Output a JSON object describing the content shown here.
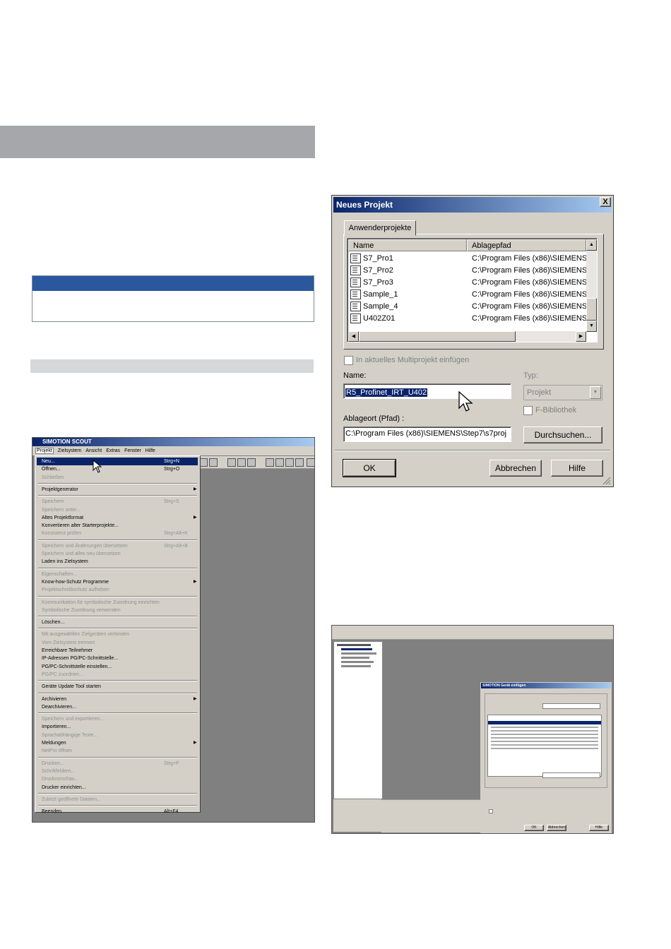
{
  "neues_projekt": {
    "title": "Neues Projekt",
    "close": "X",
    "tab_label": "Anwenderprojekte",
    "columns": [
      "Name",
      "Ablagepfad"
    ],
    "rows": [
      {
        "name": "S7_Pro1",
        "path": "C:\\Program Files (x86)\\SIEMENS\\"
      },
      {
        "name": "S7_Pro2",
        "path": "C:\\Program Files (x86)\\SIEMENS\\"
      },
      {
        "name": "S7_Pro3",
        "path": "C:\\Program Files (x86)\\SIEMENS\\"
      },
      {
        "name": "Sample_1",
        "path": "C:\\Program Files (x86)\\SIEMENS\\"
      },
      {
        "name": "Sample_4",
        "path": "C:\\Program Files (x86)\\SIEMENS\\"
      },
      {
        "name": "U402Z01",
        "path": "C:\\Program Files (x86)\\SIEMENS\\"
      }
    ],
    "multiprojekt_label": "In aktuelles Multiprojekt einfügen",
    "name_label": "Name:",
    "name_value": "R5_Profinet_IRT_U402",
    "typ_label": "Typ:",
    "typ_value": "Projekt",
    "fbib_label": "F-Bibliothek",
    "ablageort_label": "Ablageort (Pfad) :",
    "ablageort_value": "C:\\Program Files (x86)\\SIEMENS\\Step7\\s7proj",
    "durchsuchen_label": "Durchsuchen...",
    "ok_label": "OK",
    "abbrechen_label": "Abbrechen",
    "hilfe_label": "Hilfe"
  },
  "scout": {
    "title": "SIMOTION SCOUT",
    "menubar": [
      "Projekt",
      "Zielsystem",
      "Ansicht",
      "Extras",
      "Fenster",
      "Hilfe"
    ],
    "menu_items": [
      {
        "label": "Neu...",
        "shortcut": "Strg+N",
        "disabled": false,
        "highlight": true
      },
      {
        "label": "Öffnen...",
        "shortcut": "Strg+O",
        "disabled": false
      },
      {
        "label": "Schließen",
        "shortcut": "",
        "disabled": true
      },
      {
        "label": "Projektgenerator",
        "shortcut": "",
        "disabled": false,
        "submenu": true
      },
      {
        "label": "Speichern",
        "shortcut": "Strg+S",
        "disabled": true
      },
      {
        "label": "Speichern unter...",
        "shortcut": "",
        "disabled": true
      },
      {
        "label": "Altes Projektformat",
        "shortcut": "",
        "disabled": false,
        "submenu": true
      },
      {
        "label": "Konvertieren alter Starterprojekte...",
        "shortcut": "",
        "disabled": false
      },
      {
        "label": "Konsistenz prüfen",
        "shortcut": "Strg+Alt+K",
        "disabled": true
      },
      {
        "label": "Speichern und Änderungen übersetzen",
        "shortcut": "Strg+Alt+B",
        "disabled": true
      },
      {
        "label": "Speichern und alles neu übersetzen",
        "shortcut": "",
        "disabled": true
      },
      {
        "label": "Laden ins Zielsystem",
        "shortcut": "",
        "disabled": false
      },
      {
        "label": "Eigenschaften...",
        "shortcut": "",
        "disabled": true
      },
      {
        "label": "Know-how-Schutz Programme",
        "shortcut": "",
        "disabled": false,
        "submenu": true
      },
      {
        "label": "Projektschreibschutz aufheben",
        "shortcut": "",
        "disabled": true
      },
      {
        "label": "Kommunikation für symbolische Zuordnung einrichten",
        "shortcut": "",
        "disabled": true
      },
      {
        "label": "Symbolische Zuordnung verwenden",
        "shortcut": "",
        "disabled": true
      },
      {
        "label": "Löschen...",
        "shortcut": "",
        "disabled": false
      },
      {
        "label": "Mit ausgewählten Zielgeräten verbinden",
        "shortcut": "",
        "disabled": true
      },
      {
        "label": "Vom Zielsystem trennen",
        "shortcut": "",
        "disabled": true
      },
      {
        "label": "Erreichbare Teilnehmer",
        "shortcut": "",
        "disabled": false
      },
      {
        "label": "IP-Adressen PG/PC-Schnittstelle...",
        "shortcut": "",
        "disabled": false
      },
      {
        "label": "PG/PC-Schnittstelle einstellen...",
        "shortcut": "",
        "disabled": false
      },
      {
        "label": "PG/PC zuordnen...",
        "shortcut": "",
        "disabled": true
      },
      {
        "label": "Geräte Update Tool starten",
        "shortcut": "",
        "disabled": false
      },
      {
        "label": "Archivieren",
        "shortcut": "",
        "disabled": false,
        "submenu": true
      },
      {
        "label": "Dearchivieren...",
        "shortcut": "",
        "disabled": false
      },
      {
        "label": "Speichern und exportieren...",
        "shortcut": "",
        "disabled": true
      },
      {
        "label": "Importieren...",
        "shortcut": "",
        "disabled": false
      },
      {
        "label": "Sprachabhängige Texte...",
        "shortcut": "",
        "disabled": true
      },
      {
        "label": "Meldungen",
        "shortcut": "",
        "disabled": false,
        "submenu": true
      },
      {
        "label": "NetPro öffnen",
        "shortcut": "",
        "disabled": true
      },
      {
        "label": "Drucken...",
        "shortcut": "Strg+P",
        "disabled": true
      },
      {
        "label": "Schriftfeldern...",
        "shortcut": "",
        "disabled": true
      },
      {
        "label": "Druckvorschau...",
        "shortcut": "",
        "disabled": true
      },
      {
        "label": "Drucker einrichten...",
        "shortcut": "",
        "disabled": false
      },
      {
        "label": "Zuletzt geöffnete Dateien...",
        "shortcut": "",
        "disabled": true
      },
      {
        "label": "Beenden",
        "shortcut": "Alt+F4",
        "disabled": false
      }
    ]
  },
  "shot2": {
    "dialog_title": "SIMOTION Gerät einfügen",
    "ok": "OK",
    "abbrechen": "Abbrechen",
    "hilfe": "Hilfe"
  },
  "colors": {
    "title_dark": "#0a246a",
    "title_light": "#a6caf0",
    "grey_band": "#a5a7aa",
    "info_blue": "#2a579e"
  }
}
